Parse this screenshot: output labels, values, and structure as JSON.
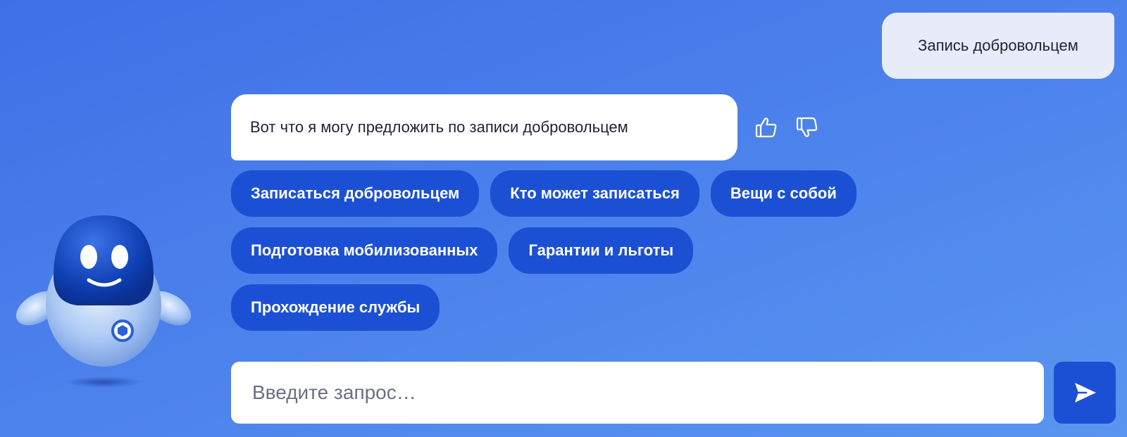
{
  "user_message": {
    "text": "Запись добровольцем"
  },
  "bot_message": {
    "text": "Вот что я могу предложить по записи добровольцем",
    "feedback": {
      "like_icon": "thumbs-up-icon",
      "dislike_icon": "thumbs-down-icon"
    }
  },
  "suggestions": {
    "rows": [
      [
        "Записаться добровольцем",
        "Кто может записаться",
        "Вещи с собой"
      ],
      [
        "Подготовка мобилизованных",
        "Гарантии и льготы"
      ],
      [
        "Прохождение службы"
      ]
    ]
  },
  "input": {
    "placeholder": "Введите запрос…",
    "value": ""
  },
  "send_button": {
    "icon": "send-icon"
  },
  "assistant": {
    "avatar": "robot-assistant-icon"
  },
  "colors": {
    "background": "#4a7fea",
    "chip": "#1c50d4",
    "user_bubble": "#e8ecf9",
    "bot_bubble": "#ffffff",
    "send_button": "#1c50d4"
  }
}
